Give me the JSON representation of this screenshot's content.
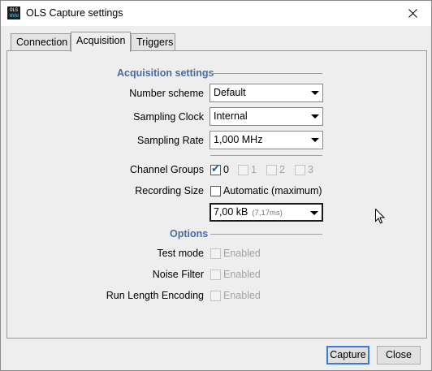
{
  "window": {
    "title": "OLS Capture settings",
    "icon_text_top": "OLS",
    "icon_text_bottom": "ꓤꓤꓤ",
    "close_glyph": "✕"
  },
  "tabs": [
    {
      "label": "Connection",
      "active": false
    },
    {
      "label": "Acquisition",
      "active": true
    },
    {
      "label": "Triggers",
      "active": false
    }
  ],
  "acquisition": {
    "section_title": "Acquisition settings",
    "number_scheme": {
      "label": "Number scheme",
      "value": "Default"
    },
    "sampling_clock": {
      "label": "Sampling Clock",
      "value": "Internal"
    },
    "sampling_rate": {
      "label": "Sampling Rate",
      "value": "1,000 MHz"
    },
    "channel_groups": {
      "label": "Channel Groups",
      "groups": [
        {
          "label": "0",
          "checked": true,
          "enabled": true
        },
        {
          "label": "1",
          "checked": false,
          "enabled": false
        },
        {
          "label": "2",
          "checked": false,
          "enabled": false
        },
        {
          "label": "3",
          "checked": false,
          "enabled": false
        }
      ]
    },
    "recording_size": {
      "label": "Recording Size",
      "automatic_label": "Automatic (maximum)",
      "automatic_checked": false,
      "value": "7,00 kB",
      "value_sub": "(7,17ms)"
    }
  },
  "options": {
    "section_title": "Options",
    "test_mode": {
      "label": "Test mode",
      "checkbox_label": "Enabled",
      "checked": false,
      "enabled": false
    },
    "noise_filter": {
      "label": "Noise Filter",
      "checkbox_label": "Enabled",
      "checked": false,
      "enabled": false
    },
    "rle": {
      "label": "Run Length Encoding",
      "checkbox_label": "Enabled",
      "checked": false,
      "enabled": false
    }
  },
  "buttons": {
    "capture": "Capture",
    "close": "Close"
  },
  "colors": {
    "section_title": "#4a6aa5",
    "check": "#1b5aa0",
    "default_button_border": "#3a7bd5"
  }
}
